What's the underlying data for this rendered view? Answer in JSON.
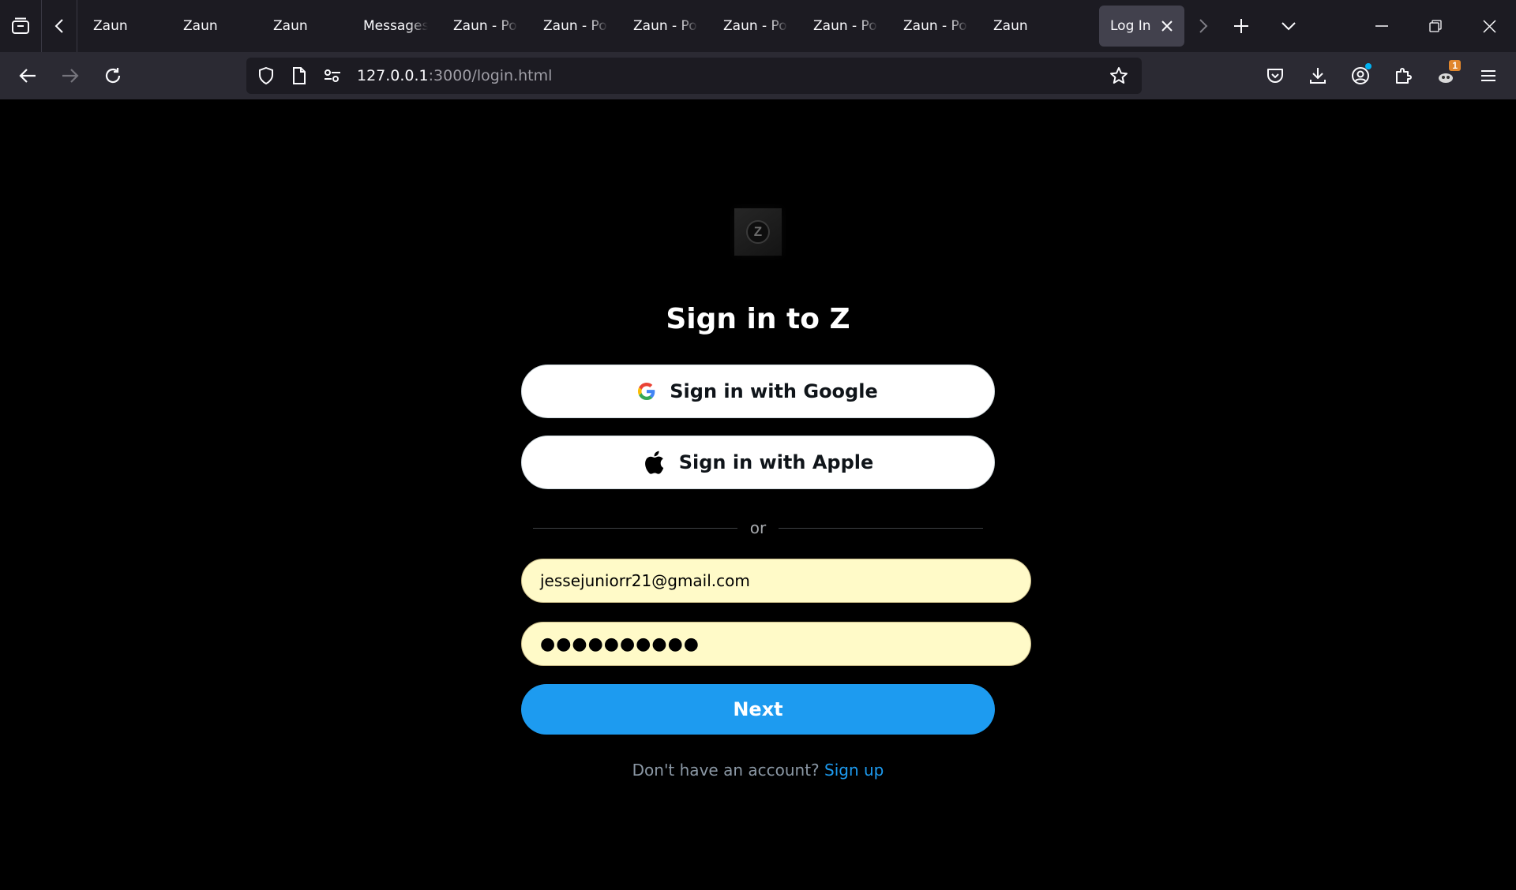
{
  "browser": {
    "tabs": [
      {
        "label": "Zaun"
      },
      {
        "label": "Zaun"
      },
      {
        "label": "Zaun"
      },
      {
        "label": "Messages"
      },
      {
        "label": "Zaun - Po"
      },
      {
        "label": "Zaun - Po"
      },
      {
        "label": "Zaun - Po"
      },
      {
        "label": "Zaun - Po"
      },
      {
        "label": "Zaun - Po"
      },
      {
        "label": "Zaun - Po"
      },
      {
        "label": "Zaun"
      }
    ],
    "active_tab": {
      "label": "Log In"
    },
    "url": {
      "host": "127.0.0.1",
      "rest": ":3000/login.html"
    },
    "extension_badge": "1"
  },
  "login": {
    "logo_letter": "Z",
    "title": "Sign in to Z",
    "google_label": "Sign in with Google",
    "apple_label": "Sign in with Apple",
    "divider_text": "or",
    "email_value": "jessejuniorr21@gmail.com",
    "password_value": "●●●●●●●●●●",
    "next_label": "Next",
    "no_account_text": "Don't have an account?",
    "signup_label": "Sign up"
  },
  "colors": {
    "accent": "#1d9bf0",
    "autofill": "#fffac8",
    "page_bg": "#000000"
  }
}
